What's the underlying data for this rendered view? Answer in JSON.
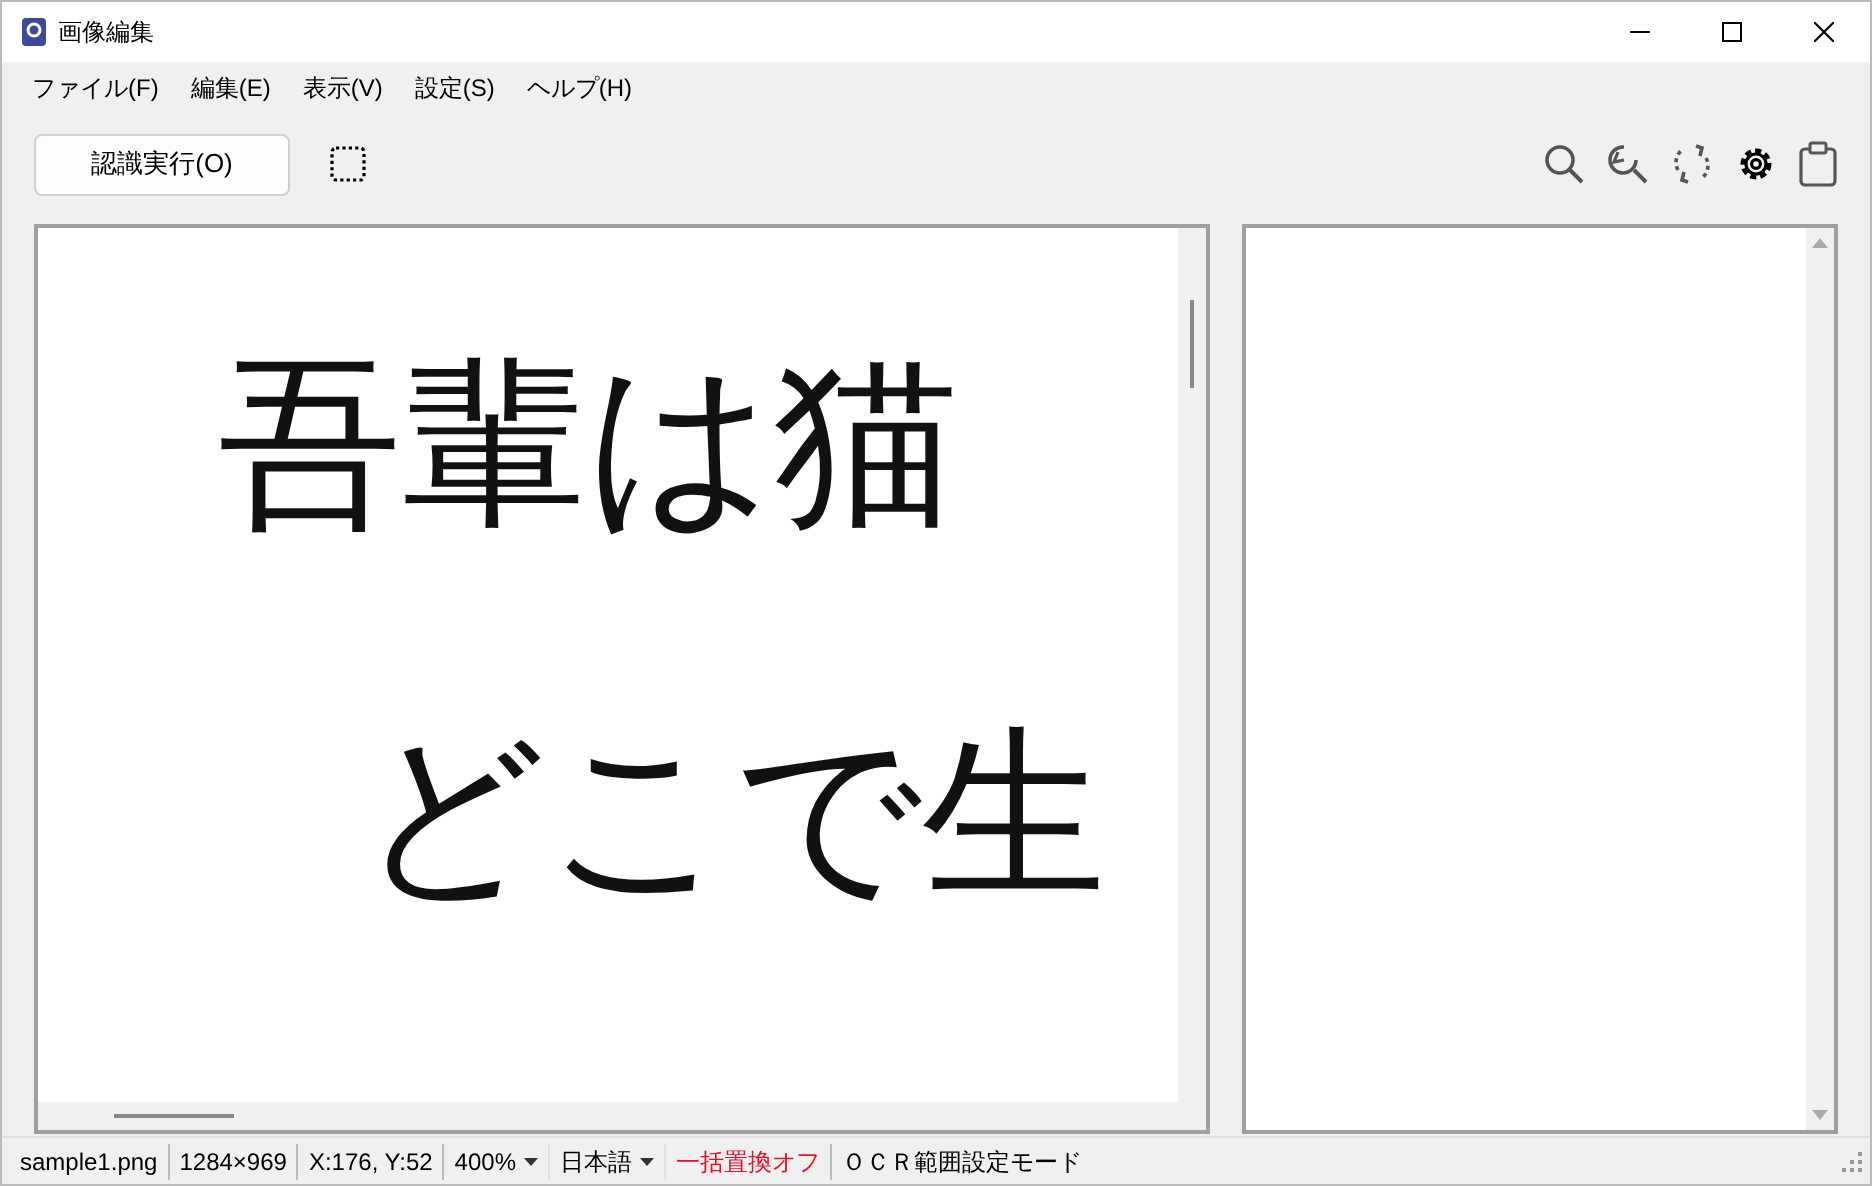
{
  "window": {
    "title": "画像編集"
  },
  "menu": [
    "ファイル(F)",
    "編集(E)",
    "表示(V)",
    "設定(S)",
    "ヘルプ(H)"
  ],
  "toolbar": {
    "run_button": "認識実行(O)"
  },
  "image_view": {
    "lines": [
      "吾輩は猫",
      "どこで生"
    ]
  },
  "status_bar": [
    {
      "kind": "text",
      "text": "sample1.png"
    },
    {
      "kind": "text",
      "text": "1284×969"
    },
    {
      "kind": "text",
      "text": "X:176, Y:52"
    },
    {
      "kind": "dropdown",
      "text": "400%"
    },
    {
      "kind": "dropdown",
      "text": "日本語"
    },
    {
      "kind": "text",
      "text": "一括置換オフ",
      "color": "#e81123"
    },
    {
      "kind": "text",
      "text": "ＯＣＲ範囲設定モード"
    }
  ]
}
